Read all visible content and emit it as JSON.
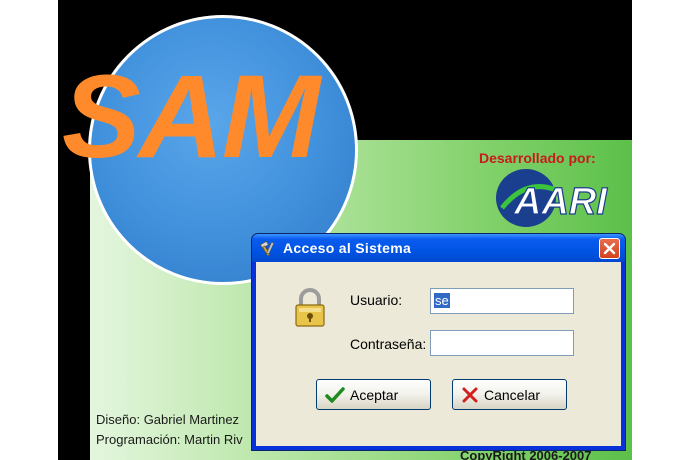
{
  "splash": {
    "app_name": "SAM",
    "developed_by": "Desarrollado por:",
    "logo_text": "AARI",
    "credits": [
      "Diseño: Gabriel Martinez",
      "Programación: Martin Riv"
    ],
    "copyright": "CopyRight 2006-2007"
  },
  "dialog": {
    "title": "Acceso al Sistema",
    "user_label": "Usuario:",
    "user_value": "se",
    "pass_label": "Contraseña:",
    "pass_value": "",
    "ok_label": "Aceptar",
    "cancel_label": "Cancelar"
  },
  "colors": {
    "title_accent": "#ff8a2b",
    "developer_label": "#c81b1b",
    "titlebar": "#0054e3",
    "close_button": "#d2421d"
  }
}
